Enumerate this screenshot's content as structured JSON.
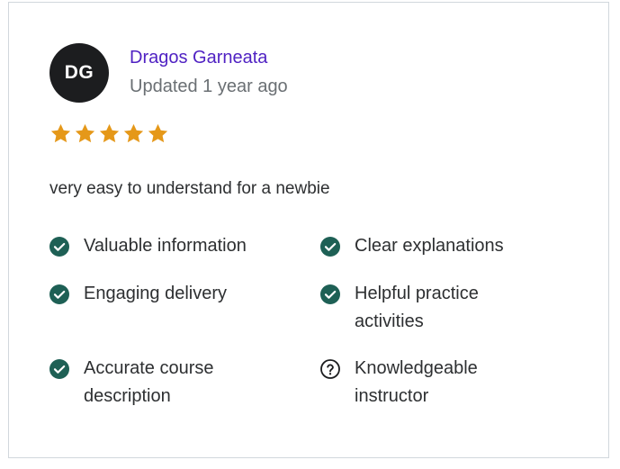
{
  "review": {
    "avatar_initials": "DG",
    "reviewer_name": "Dragos Garneata",
    "updated": "Updated 1 year ago",
    "rating": 5,
    "rating_max": 5,
    "comment": "very easy to understand for a newbie",
    "features": [
      {
        "label": "Valuable information",
        "status": "yes",
        "icon": "check-circle-icon"
      },
      {
        "label": "Clear explanations",
        "status": "yes",
        "icon": "check-circle-icon"
      },
      {
        "label": "Engaging delivery",
        "status": "yes",
        "icon": "check-circle-icon"
      },
      {
        "label": "Helpful practice activities",
        "status": "yes",
        "icon": "check-circle-icon"
      },
      {
        "label": "Accurate course description",
        "status": "yes",
        "icon": "check-circle-icon"
      },
      {
        "label": "Knowledgeable instructor",
        "status": "unsure",
        "icon": "question-circle-icon"
      }
    ]
  },
  "colors": {
    "star": "#e59819",
    "check": "#1e6055",
    "name": "#5022c3",
    "avatar_bg": "#1c1d1f"
  }
}
